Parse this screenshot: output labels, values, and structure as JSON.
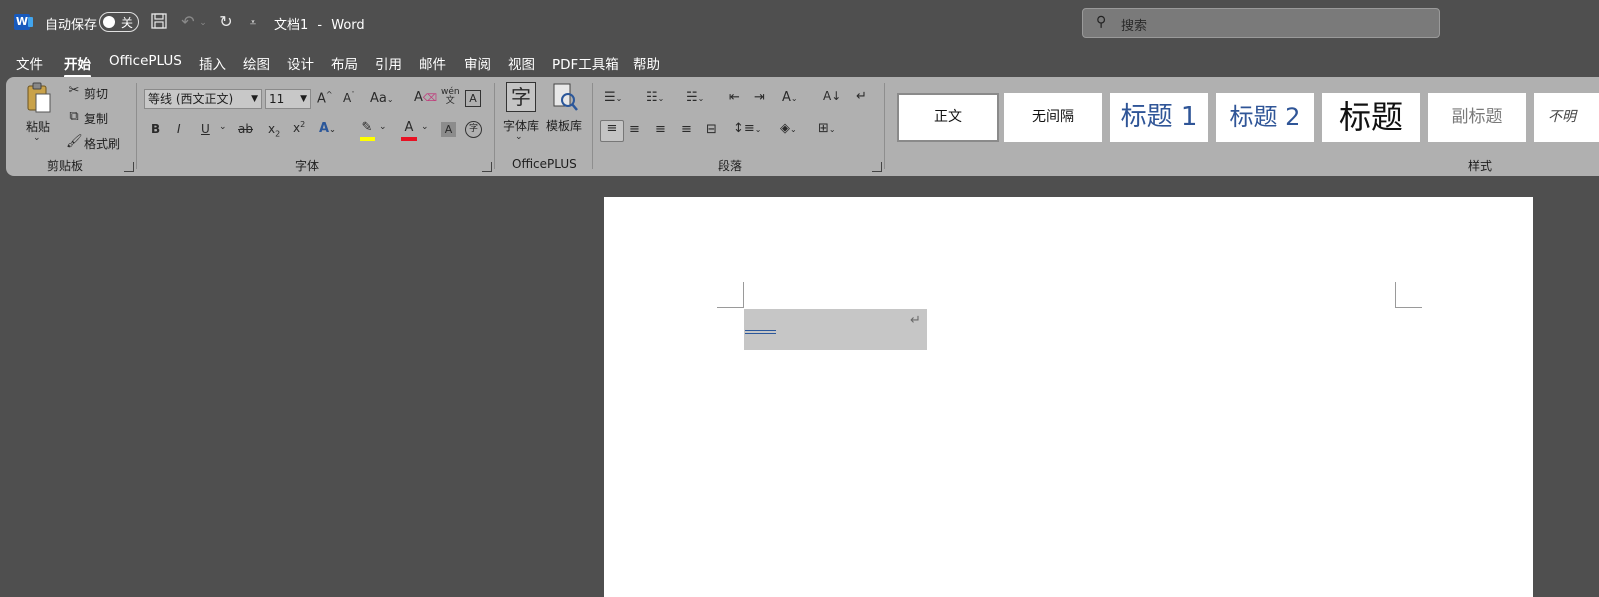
{
  "titlebar": {
    "autosave_label": "自动保存",
    "autosave_state": "关",
    "doc_title": "文档1",
    "separator": "-",
    "app_name": "Word",
    "search_placeholder": "搜索"
  },
  "tabs": [
    {
      "label": "文件"
    },
    {
      "label": "开始",
      "active": true
    },
    {
      "label": "OfficePLUS"
    },
    {
      "label": "插入"
    },
    {
      "label": "绘图"
    },
    {
      "label": "设计"
    },
    {
      "label": "布局"
    },
    {
      "label": "引用"
    },
    {
      "label": "邮件"
    },
    {
      "label": "审阅"
    },
    {
      "label": "视图"
    },
    {
      "label": "PDF工具箱"
    },
    {
      "label": "帮助"
    }
  ],
  "ribbon": {
    "clipboard": {
      "paste": "粘贴",
      "cut": "剪切",
      "copy": "复制",
      "format_painter": "格式刷",
      "group_label": "剪贴板"
    },
    "font": {
      "font_name": "等线 (西文正文)",
      "font_size": "11",
      "group_label": "字体"
    },
    "officeplus": {
      "font_library": "字体库",
      "template_library": "模板库",
      "group_label": "OfficePLUS"
    },
    "paragraph": {
      "group_label": "段落"
    },
    "styles": {
      "items": [
        "正文",
        "无间隔",
        "标题 1",
        "标题 2",
        "标题",
        "副标题",
        "不明"
      ],
      "group_label": "样式"
    }
  },
  "colors": {
    "accent_blue": "#2b579a",
    "highlight_yellow": "#ffff00",
    "font_color_red": "#e81123",
    "ribbon_bg": "#b0b0b0",
    "window_bg": "#4f4f4f"
  }
}
